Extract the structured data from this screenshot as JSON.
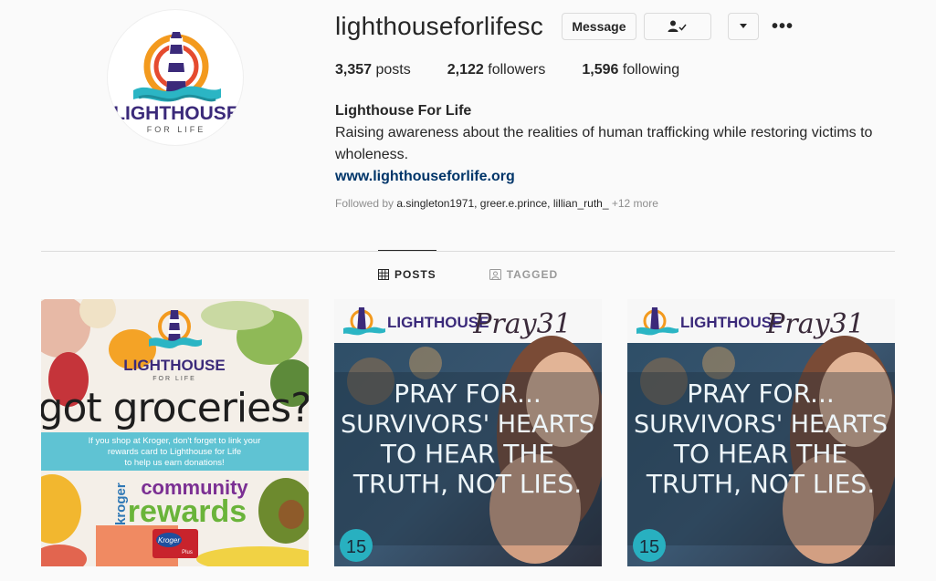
{
  "profile": {
    "username": "lighthouseforlifesc",
    "logo_text_main": "LIGHTHOUSE",
    "logo_text_sub": "FOR LIFE"
  },
  "actions": {
    "message_label": "Message",
    "following_icon": "person-check-icon",
    "dropdown_icon": "chevron-down-icon",
    "more_icon": "more-horizontal-icon",
    "more_glyph": "•••"
  },
  "stats": {
    "posts_count": "3,357",
    "posts_label": "posts",
    "followers_count": "2,122",
    "followers_label": "followers",
    "following_count": "1,596",
    "following_label": "following"
  },
  "bio": {
    "name": "Lighthouse For Life",
    "text": "Raising awareness about the realities of human trafficking while restoring victims to wholeness.",
    "link": "www.lighthouseforlife.org"
  },
  "followed_by": {
    "prefix": "Followed by ",
    "names": "a.singleton1971, greer.e.prince, lillian_ruth_",
    "more": " +12 more"
  },
  "tabs": [
    {
      "label": "POSTS",
      "icon": "grid-icon"
    },
    {
      "label": "TAGGED",
      "icon": "tagged-icon"
    }
  ],
  "posts": [
    {
      "logo_main": "LIGHTHOUSE",
      "logo_sub": "FOR LIFE",
      "headline": "got groceries?",
      "banner_line1": "If you shop at Kroger, don't forget to link your",
      "banner_line2": "rewards card to Lighthouse for Life",
      "banner_line3": "to help us earn donations!",
      "brand_side": "kroger",
      "brand_top": "community",
      "brand_bottom": "rewards",
      "card_text": "Kroger",
      "card_sub": "Plus"
    },
    {
      "logo_main": "LIGHTHOUSE",
      "script_title": "Pray31",
      "line1": "PRAY FOR...",
      "line2": "SURVIVORS' HEARTS",
      "line3": "TO HEAR THE",
      "line4": "TRUTH, NOT LIES.",
      "day": "15"
    },
    {
      "logo_main": "LIGHTHOUSE",
      "script_title": "Pray31",
      "line1": "PRAY FOR...",
      "line2": "SURVIVORS' HEARTS",
      "line3": "TO HEAR THE",
      "line4": "TRUTH, NOT LIES.",
      "day": "15"
    }
  ],
  "colors": {
    "purple": "#3b2a7a",
    "teal": "#2bb5c4",
    "orange": "#f39a1e",
    "link": "#003569"
  }
}
